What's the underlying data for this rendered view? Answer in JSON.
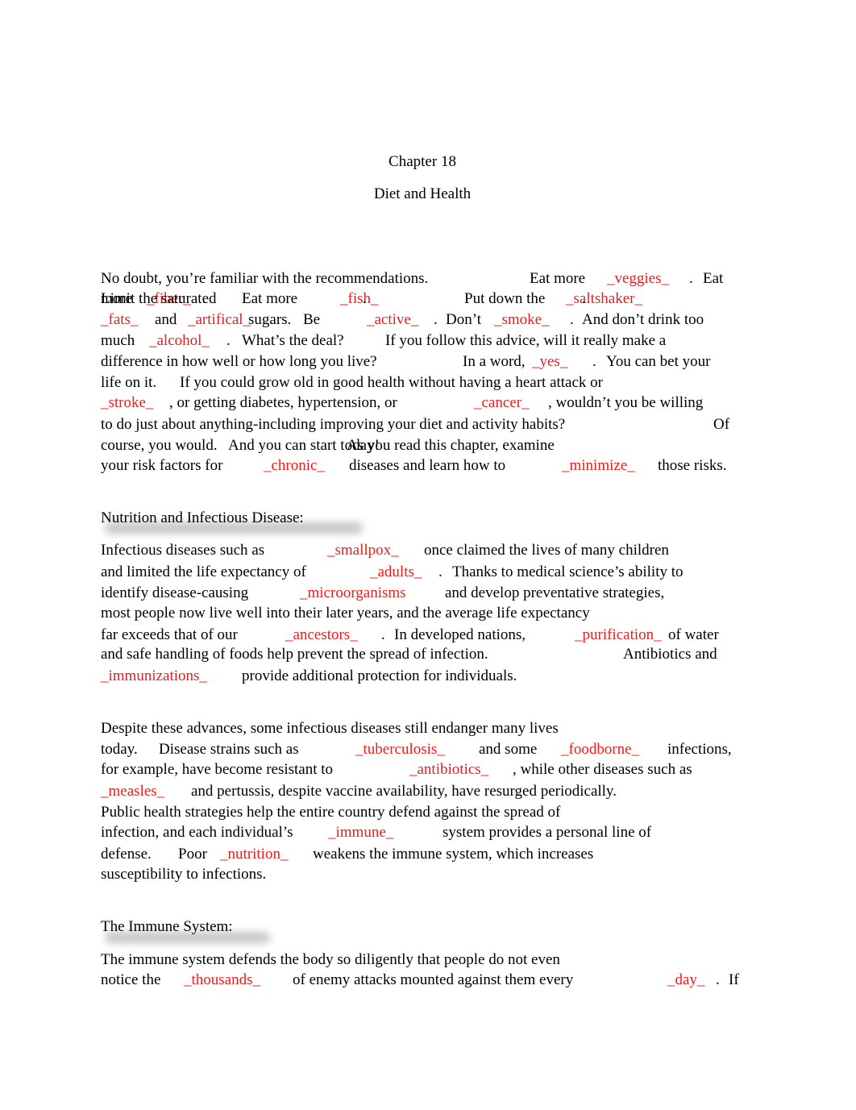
{
  "document": {
    "chapter": "Chapter 18",
    "title": "Diet and Health",
    "answer_color": "#ee1c1c"
  },
  "intro": {
    "lines": [
      [
        {
          "t": "No doubt, you’re familiar with the recommendations."
        },
        {
          "t": "Eat more"
        },
        {
          "t": "_veggies_",
          "a": true
        },
        {
          "t": "."
        },
        {
          "t": "Eat"
        }
      ],
      [
        {
          "t": "more"
        },
        {
          "t": "_fiber_",
          "a": true
        },
        {
          "t": "."
        },
        {
          "t": "Eat more"
        },
        {
          "t": "_fish_",
          "a": true
        },
        {
          "t": "."
        },
        {
          "t": "Put down the"
        },
        {
          "t": "_saltshaker_",
          "a": true
        },
        {
          "t": "."
        },
        {
          "t": "Limit the saturated"
        }
      ],
      [
        {
          "t": "_fats_",
          "a": true
        },
        {
          "t": "and"
        },
        {
          "t": "_artifical_",
          "a": true
        },
        {
          "t": "sugars."
        },
        {
          "t": "Be"
        },
        {
          "t": "_active_",
          "a": true
        },
        {
          "t": "."
        },
        {
          "t": "Don’t"
        },
        {
          "t": "_smoke_",
          "a": true
        },
        {
          "t": "."
        },
        {
          "t": "And don’t drink too"
        }
      ],
      [
        {
          "t": "much"
        },
        {
          "t": "_alcohol_",
          "a": true
        },
        {
          "t": "."
        },
        {
          "t": "What’s the deal?"
        },
        {
          "t": "If you follow this advice, will it really make a"
        }
      ],
      [
        {
          "t": "difference in how well or how long you live?"
        },
        {
          "t": "In a word,"
        },
        {
          "t": "_yes_",
          "a": true
        },
        {
          "t": "."
        },
        {
          "t": "You can bet your"
        }
      ],
      [
        {
          "t": "life on it."
        },
        {
          "t": "If you could grow old in good health without having a heart attack or"
        }
      ],
      [
        {
          "t": "_stroke_",
          "a": true
        },
        {
          "t": ", or getting diabetes, hypertension, or"
        },
        {
          "t": "_cancer_",
          "a": true
        },
        {
          "t": ", wouldn’t you be willing"
        }
      ],
      [
        {
          "t": "to do just about anything-including improving your diet and activity habits?"
        },
        {
          "t": "Of"
        }
      ],
      [
        {
          "t": "course, you would."
        },
        {
          "t": "And you can start today!"
        },
        {
          "t": "As you read this chapter, examine"
        }
      ],
      [
        {
          "t": "your risk factors for"
        },
        {
          "t": "_chronic_",
          "a": true
        },
        {
          "t": "diseases and learn how to"
        },
        {
          "t": "_minimize_",
          "a": true
        },
        {
          "t": "those risks."
        }
      ]
    ]
  },
  "section1": {
    "heading": "Nutrition and Infectious Disease:",
    "para1": [
      [
        {
          "t": "Infectious diseases such as"
        },
        {
          "t": "_smallpox_",
          "a": true
        },
        {
          "t": "once claimed the lives of many children"
        }
      ],
      [
        {
          "t": "and limited the life expectancy of"
        },
        {
          "t": "_adults_",
          "a": true
        },
        {
          "t": "."
        },
        {
          "t": "Thanks to medical science’s ability to"
        }
      ],
      [
        {
          "t": "identify disease-causing"
        },
        {
          "t": "_microorganisms",
          "a": true
        },
        {
          "t": "and develop preventative strategies,"
        }
      ],
      [
        {
          "t": "most people now live well into their later years, and the average life expectancy"
        }
      ],
      [
        {
          "t": "far exceeds that of our"
        },
        {
          "t": "_ancestors_",
          "a": true
        },
        {
          "t": "."
        },
        {
          "t": "In developed nations,"
        },
        {
          "t": "_purification_",
          "a": true
        },
        {
          "t": "of water"
        }
      ],
      [
        {
          "t": "and safe handling of foods help prevent the spread of infection."
        },
        {
          "t": "Antibiotics and"
        }
      ],
      [
        {
          "t": "_immunizations_",
          "a": true
        },
        {
          "t": "provide additional protection for individuals."
        }
      ]
    ],
    "para2": [
      [
        {
          "t": "Despite these advances, some infectious diseases still endanger many lives"
        }
      ],
      [
        {
          "t": "today."
        },
        {
          "t": "Disease strains such as"
        },
        {
          "t": "_tuberculosis_",
          "a": true
        },
        {
          "t": "and some"
        },
        {
          "t": "_foodborne_",
          "a": true
        },
        {
          "t": "infections,"
        }
      ],
      [
        {
          "t": "for example, have become resistant to"
        },
        {
          "t": "_antibiotics_",
          "a": true
        },
        {
          "t": ", while other diseases such as"
        }
      ],
      [
        {
          "t": "_measles_",
          "a": true
        },
        {
          "t": "and pertussis, despite vaccine availability, have resurged periodically."
        }
      ],
      [
        {
          "t": "Public health strategies help the entire country defend against the spread of"
        }
      ],
      [
        {
          "t": "infection, and each individual’s"
        },
        {
          "t": "_immune_",
          "a": true
        },
        {
          "t": "system provides a personal line of"
        }
      ],
      [
        {
          "t": "defense."
        },
        {
          "t": "Poor"
        },
        {
          "t": "_nutrition_",
          "a": true
        },
        {
          "t": "weakens the immune system, which increases"
        }
      ],
      [
        {
          "t": "susceptibility to infections."
        }
      ]
    ]
  },
  "section2": {
    "heading": "The Immune System:",
    "para1": [
      [
        {
          "t": "The immune system defends the body so diligently that people do not even"
        }
      ],
      [
        {
          "t": "notice the"
        },
        {
          "t": "_thousands_",
          "a": true
        },
        {
          "t": "of enemy attacks mounted against them every"
        },
        {
          "t": "_day_",
          "a": true
        },
        {
          "t": "."
        },
        {
          "t": "If"
        }
      ]
    ]
  }
}
